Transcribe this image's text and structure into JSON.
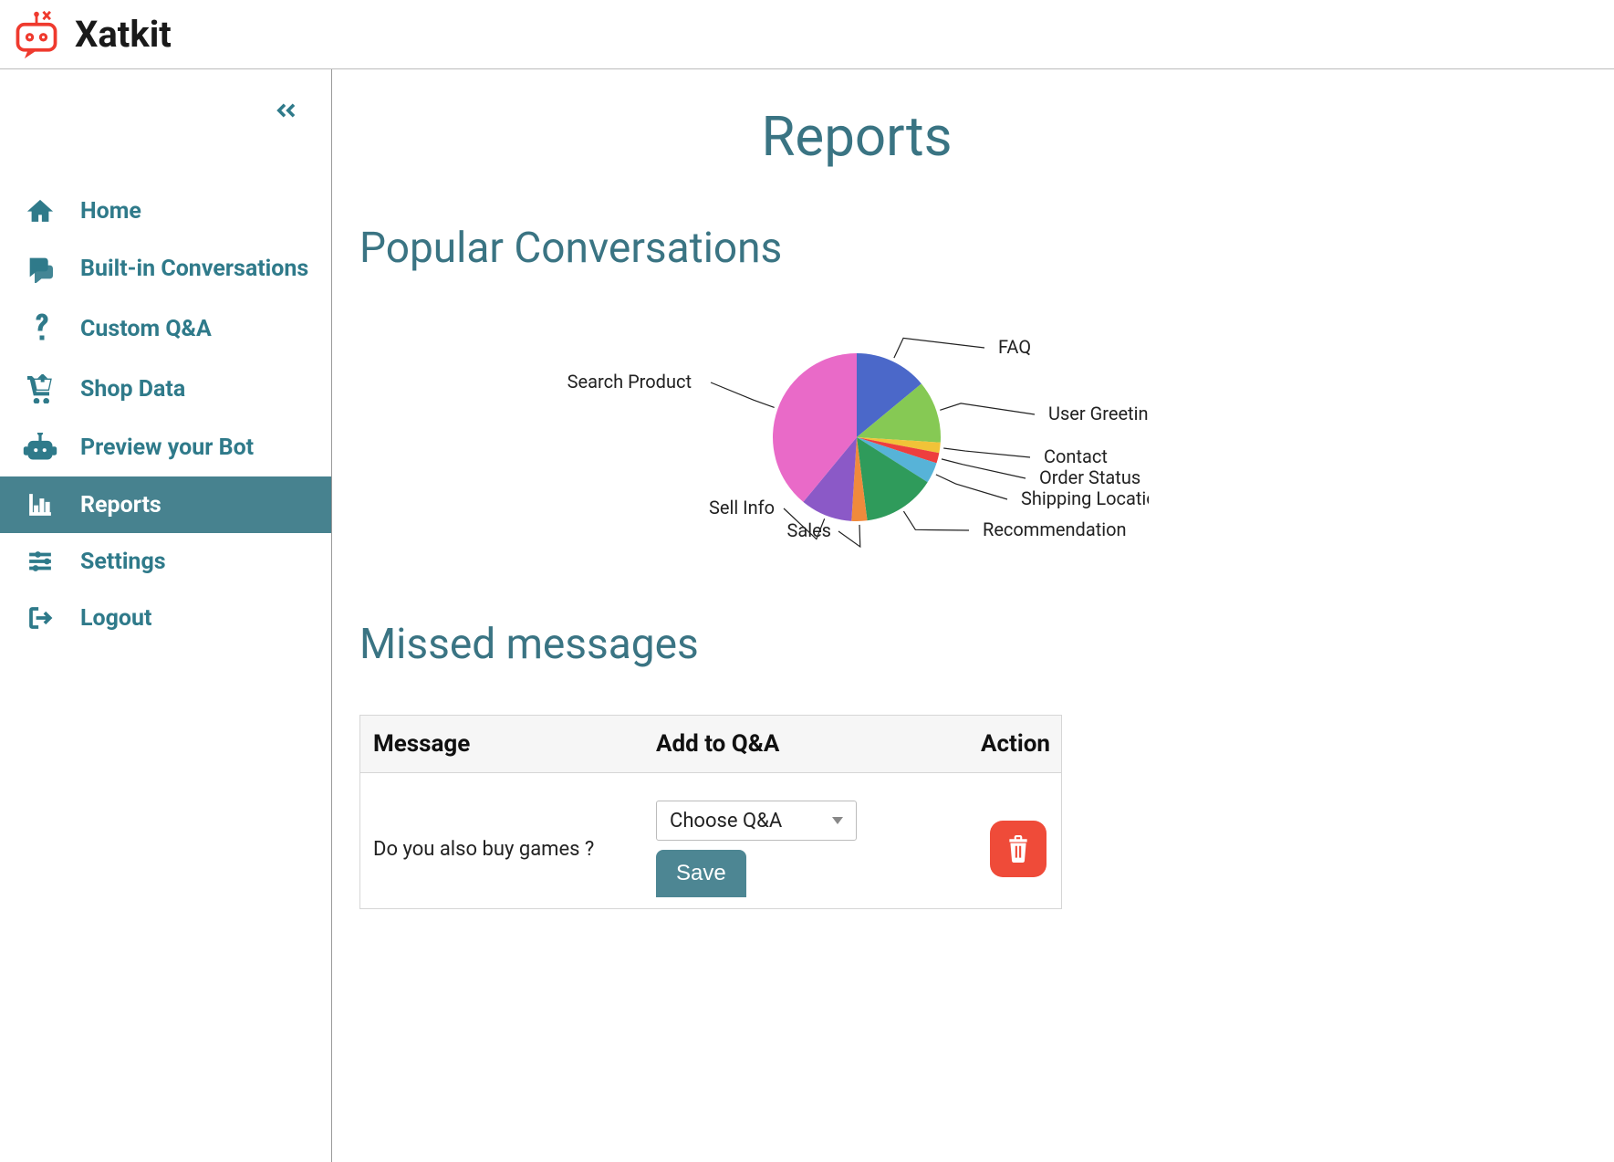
{
  "brand": {
    "name": "Xatkit"
  },
  "sidebar": {
    "items": [
      {
        "label": "Home",
        "icon": "home-icon",
        "active": false
      },
      {
        "label": "Built-in Conversations",
        "icon": "chat-icon",
        "active": false
      },
      {
        "label": "Custom Q&A",
        "icon": "question-icon",
        "active": false
      },
      {
        "label": "Shop Data",
        "icon": "cart-icon",
        "active": false
      },
      {
        "label": "Preview your Bot",
        "icon": "robot-icon",
        "active": false
      },
      {
        "label": "Reports",
        "icon": "chart-icon",
        "active": true
      },
      {
        "label": "Settings",
        "icon": "sliders-icon",
        "active": false
      },
      {
        "label": "Logout",
        "icon": "logout-icon",
        "active": false
      }
    ]
  },
  "page": {
    "title": "Reports",
    "section_popular": "Popular Conversations",
    "section_missed": "Missed messages"
  },
  "chart_data": {
    "type": "pie",
    "title": "Popular Conversations",
    "series": [
      {
        "name": "FAQ",
        "value": 14,
        "color": "#4b68c9"
      },
      {
        "name": "User Greetings",
        "value": 12,
        "color": "#86c954"
      },
      {
        "name": "Contact",
        "value": 2,
        "color": "#f1c338"
      },
      {
        "name": "Order Status",
        "value": 2,
        "color": "#ee3e3e"
      },
      {
        "name": "Shipping Location",
        "value": 4,
        "color": "#57b3d8"
      },
      {
        "name": "Recommendation",
        "value": 14,
        "color": "#2f9b5b"
      },
      {
        "name": "Sales",
        "value": 3,
        "color": "#f08a3c"
      },
      {
        "name": "Sell Info",
        "value": 10,
        "color": "#8b59c7"
      },
      {
        "name": "Search Product",
        "value": 39,
        "color": "#e96ac8"
      }
    ]
  },
  "missed": {
    "headers": {
      "message": "Message",
      "add": "Add to Q&A",
      "action": "Action"
    },
    "select_placeholder": "Choose Q&A",
    "save_label": "Save",
    "rows": [
      {
        "message": "Do you also buy games ?"
      }
    ]
  }
}
